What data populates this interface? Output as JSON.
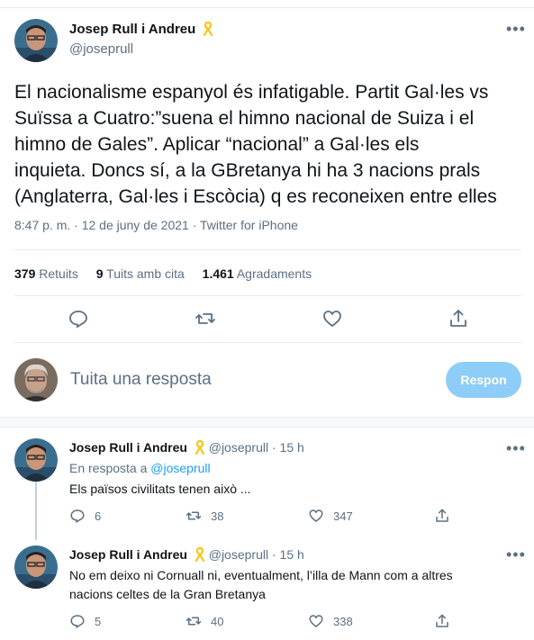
{
  "main_tweet": {
    "author_name": "Josep Rull i Andreu",
    "author_handle": "@joseprull",
    "text_lines": [
      "El nacionalisme espanyol és infatigable. Partit Gal·les vs",
      "Suïssa a Cuatro:”suena el himno nacional de Suiza i el",
      "himno de Gales”. Aplicar “nacional” a Gal·les els",
      "inquieta. Doncs sí, a la GBretanya hi ha 3 nacions prals",
      "(Anglaterra, Gal·les i Escòcia) q es reconeixen entre elles"
    ],
    "meta": "8:47 p. m. · 12 de juny de 2021 · Twitter for iPhone",
    "stats": {
      "retweets_count": "379",
      "retweets_label": "Retuits",
      "quotes_count": "9",
      "quotes_label": "Tuits amb cita",
      "likes_count": "1.461",
      "likes_label": "Agradaments"
    }
  },
  "reply_box": {
    "placeholder": "Tuita una resposta",
    "button_label": "Respon"
  },
  "replies": [
    {
      "author_name": "Josep Rull i Andreu",
      "author_handle": "@joseprull",
      "time": "· 15 h",
      "in_reply_prefix": "En resposta a",
      "in_reply_handle": "@joseprull",
      "text_lines": [
        "Els països civilitats tenen això ..."
      ],
      "replies": "6",
      "retweets": "38",
      "likes": "347"
    },
    {
      "author_name": "Josep Rull i Andreu",
      "author_handle": "@joseprull",
      "time": "· 15 h",
      "text_lines": [
        "No em deixo ni Cornuall ni, eventualment, l’illa de Mann com a altres",
        "nacions celtes de la Gran Bretanya"
      ],
      "replies": "5",
      "retweets": "40",
      "likes": "338"
    }
  ],
  "icons": {
    "more": "more-icon",
    "reply": "reply-icon",
    "retweet": "retweet-icon",
    "like": "like-icon",
    "share": "share-icon",
    "ribbon": "yellow-ribbon-icon"
  },
  "colors": {
    "accent": "#1da1f2",
    "muted": "#5b7083",
    "reply_button": "#8ecdf8",
    "ribbon": "#f5c518"
  }
}
